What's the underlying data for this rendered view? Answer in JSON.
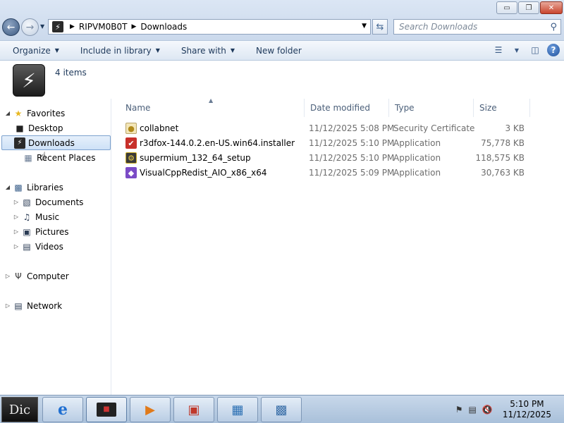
{
  "window": {
    "buttons": {
      "minimize": "▭",
      "maximize": "❐",
      "close": "✕"
    }
  },
  "address": {
    "crumbs": [
      "RIPVM0B0T",
      "Downloads"
    ]
  },
  "search": {
    "placeholder": "Search Downloads"
  },
  "commandbar": {
    "organize": "Organize",
    "include_in_library": "Include in library",
    "share_with": "Share with",
    "new_folder": "New folder"
  },
  "info": {
    "item_count": "4 items"
  },
  "nav": {
    "favorites": "Favorites",
    "desktop": "Desktop",
    "downloads": "Downloads",
    "recent_places": "Recent Places",
    "libraries": "Libraries",
    "documents": "Documents",
    "music": "Music",
    "pictures": "Pictures",
    "videos": "Videos",
    "computer": "Computer",
    "network": "Network"
  },
  "columns": {
    "name": "Name",
    "date_modified": "Date modified",
    "type": "Type",
    "size": "Size"
  },
  "files": [
    {
      "name": "collabnet",
      "date": "11/12/2025 5:08 PM",
      "type": "Security Certificate",
      "size": "3 KB",
      "icon": "certificate-icon"
    },
    {
      "name": "r3dfox-144.0.2.en-US.win64.installer",
      "date": "11/12/2025 5:10 PM",
      "type": "Application",
      "size": "75,778 KB",
      "icon": "r3dfox-installer-icon"
    },
    {
      "name": "supermium_132_64_setup",
      "date": "11/12/2025 5:10 PM",
      "type": "Application",
      "size": "118,575 KB",
      "icon": "setup-icon"
    },
    {
      "name": "VisualCppRedist_AIO_x86_x64",
      "date": "11/12/2025 5:09 PM",
      "type": "Application",
      "size": "30,763 KB",
      "icon": "vcredist-icon"
    }
  ],
  "taskbar": {
    "start_label": "Dic",
    "clock_time": "5:10 PM",
    "clock_date": "11/12/2025"
  },
  "colors": {
    "selection_border": "#7da2ce",
    "link_text": "#1e395b",
    "meta_text": "#6d6d6d"
  }
}
